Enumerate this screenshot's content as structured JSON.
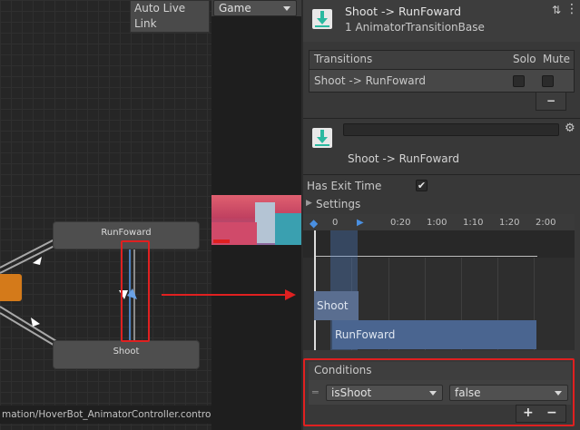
{
  "graph": {
    "auto_live_link": "Auto Live Link",
    "state_runforward": "RunFoward",
    "state_shoot": "Shoot",
    "path": "mation/HoverBot_AnimatorController.controller"
  },
  "game": {
    "dropdown": "Game"
  },
  "inspector": {
    "header_title": "Shoot -> RunFoward",
    "header_subtitle": "1 AnimatorTransitionBase",
    "transitions_label": "Transitions",
    "solo_label": "Solo",
    "mute_label": "Mute",
    "transition_item": "Shoot -> RunFoward",
    "minus": "−",
    "transition_name": "Shoot -> RunFoward",
    "has_exit_time_label": "Has Exit Time",
    "has_exit_time_check": "✔",
    "settings_label": "Settings",
    "timeline_ticks": [
      "0",
      "0:20",
      "1:00",
      "1:10",
      "1:20",
      "2:00"
    ],
    "clip_shoot": "Shoot",
    "clip_runforward": "RunFoward",
    "conditions_label": "Conditions",
    "condition_param": "isShoot",
    "condition_value": "false",
    "plus": "+",
    "minus2": "−"
  },
  "colors": {
    "highlight_red": "#e02020",
    "accent_blue": "#4a7fc0"
  }
}
